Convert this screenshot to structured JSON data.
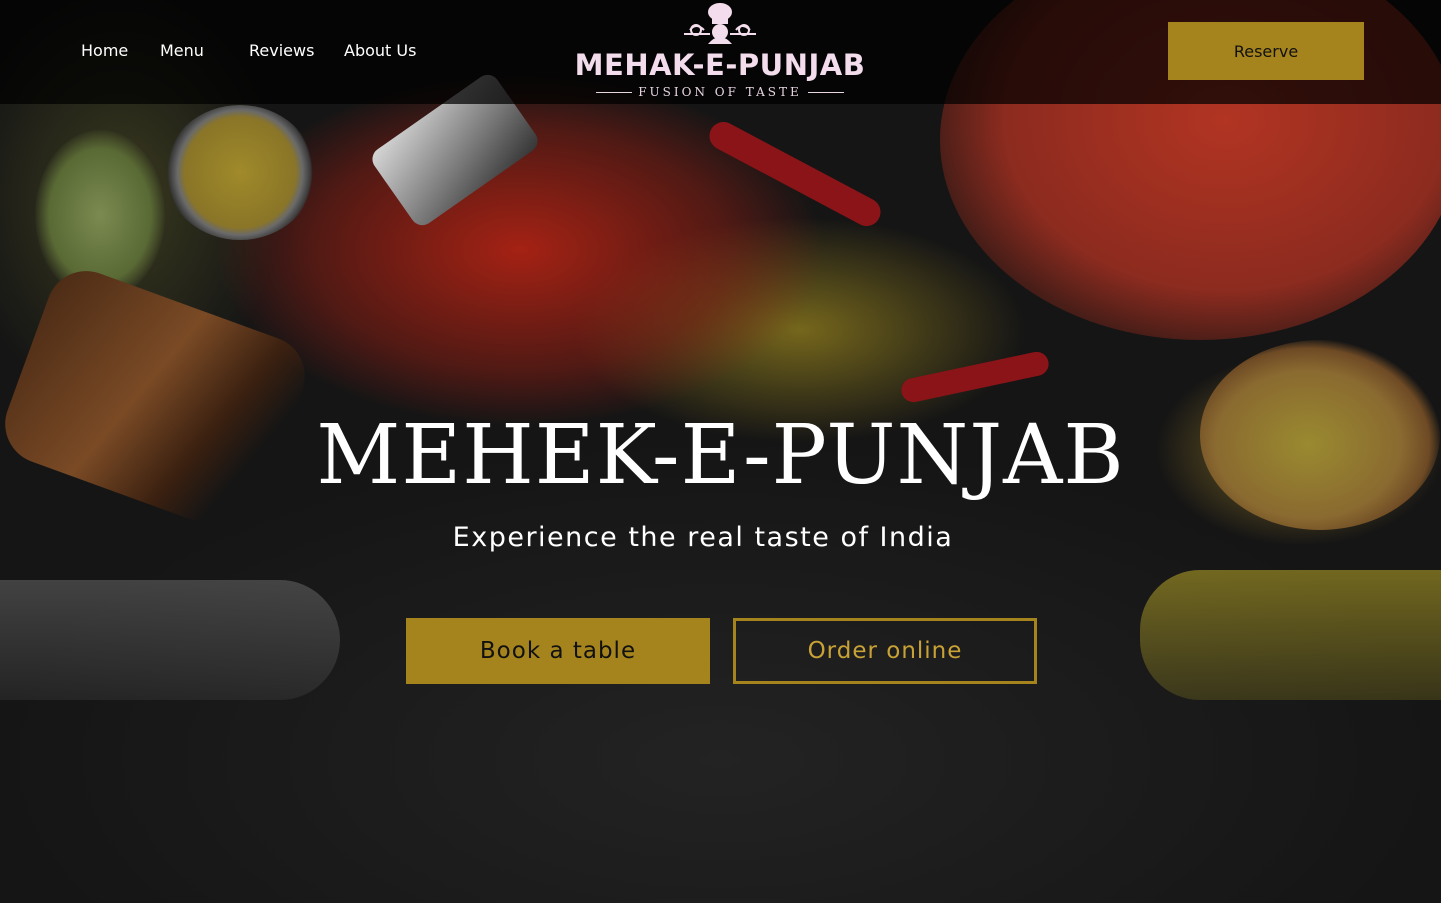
{
  "nav": {
    "home": "Home",
    "menu": "Menu",
    "reviews": "Reviews",
    "about": "About Us"
  },
  "logo": {
    "name": "MEHAK-E-PUNJAB",
    "tagline": "FUSION OF TASTE"
  },
  "header": {
    "reserve_label": "Reserve"
  },
  "hero": {
    "title": "MEHEK-E-PUNJAB",
    "subtitle": "Experience the real taste of India",
    "book_label": "Book a table",
    "order_label": "Order online"
  },
  "colors": {
    "accent": "#a6841d",
    "logo_text": "#f3dcec",
    "header_bg": "#000000"
  }
}
